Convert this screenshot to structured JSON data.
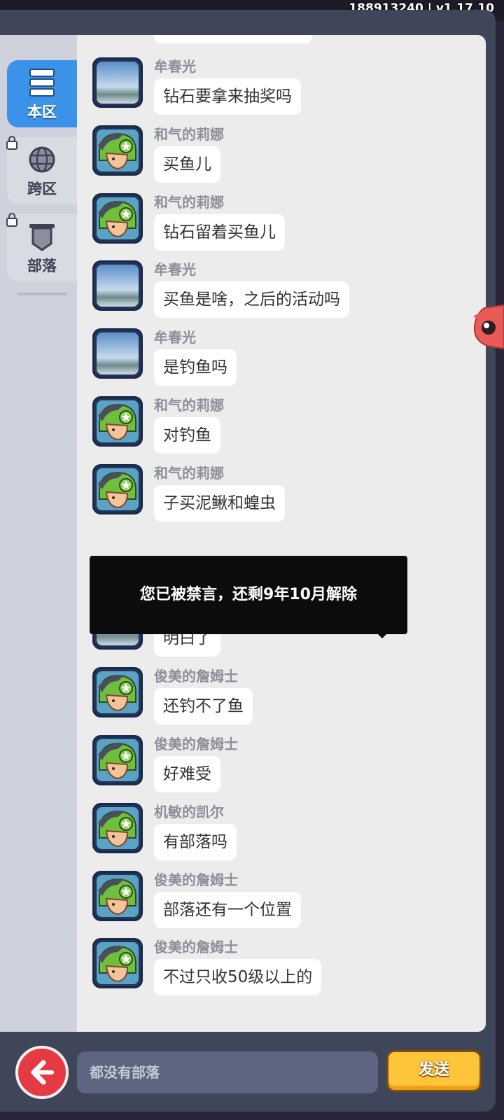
{
  "version": "188913240 | v1.17.10",
  "sidebar": {
    "tabs": [
      {
        "label": "本区",
        "icon": "server-list-icon",
        "active": true,
        "locked": false
      },
      {
        "label": "跨区",
        "icon": "globe-icon",
        "active": false,
        "locked": true
      },
      {
        "label": "部落",
        "icon": "shield-banner-icon",
        "active": false,
        "locked": true
      }
    ]
  },
  "messages": [
    {
      "user": "牟春光",
      "text": "钻石要拿来抽奖吗",
      "avatar": "sky"
    },
    {
      "user": "和气的莉娜",
      "text": "买鱼儿",
      "avatar": "hero"
    },
    {
      "user": "和气的莉娜",
      "text": "钻石留着买鱼儿",
      "avatar": "hero"
    },
    {
      "user": "牟春光",
      "text": "买鱼是啥，之后的活动吗",
      "avatar": "sky"
    },
    {
      "user": "牟春光",
      "text": "是钓鱼吗",
      "avatar": "sky"
    },
    {
      "user": "和气的莉娜",
      "text": "对钓鱼",
      "avatar": "hero"
    },
    {
      "user": "和气的莉娜",
      "text": "子买泥鳅和蝗虫",
      "avatar": "hero"
    },
    {
      "user": "牟春光",
      "text": "明白了",
      "avatar": "sky"
    },
    {
      "user": "俊美的詹姆士",
      "text": "还钓不了鱼",
      "avatar": "hero"
    },
    {
      "user": "俊美的詹姆士",
      "text": "好难受",
      "avatar": "hero"
    },
    {
      "user": "机敏的凯尔",
      "text": "有部落吗",
      "avatar": "hero"
    },
    {
      "user": "俊美的詹姆士",
      "text": "部落还有一个位置",
      "avatar": "hero"
    },
    {
      "user": "俊美的詹姆士",
      "text": "不过只收50级以上的",
      "avatar": "hero"
    }
  ],
  "toast": "您已被禁言，还剩9年10月解除",
  "input": {
    "placeholder": "都没有部落",
    "value": ""
  },
  "send_label": "发送",
  "colors": {
    "active_tab": "#3a93e8",
    "send_button": "#ffc53a",
    "back_button": "#e53a43",
    "toast_bg": "#0c0c0e"
  }
}
